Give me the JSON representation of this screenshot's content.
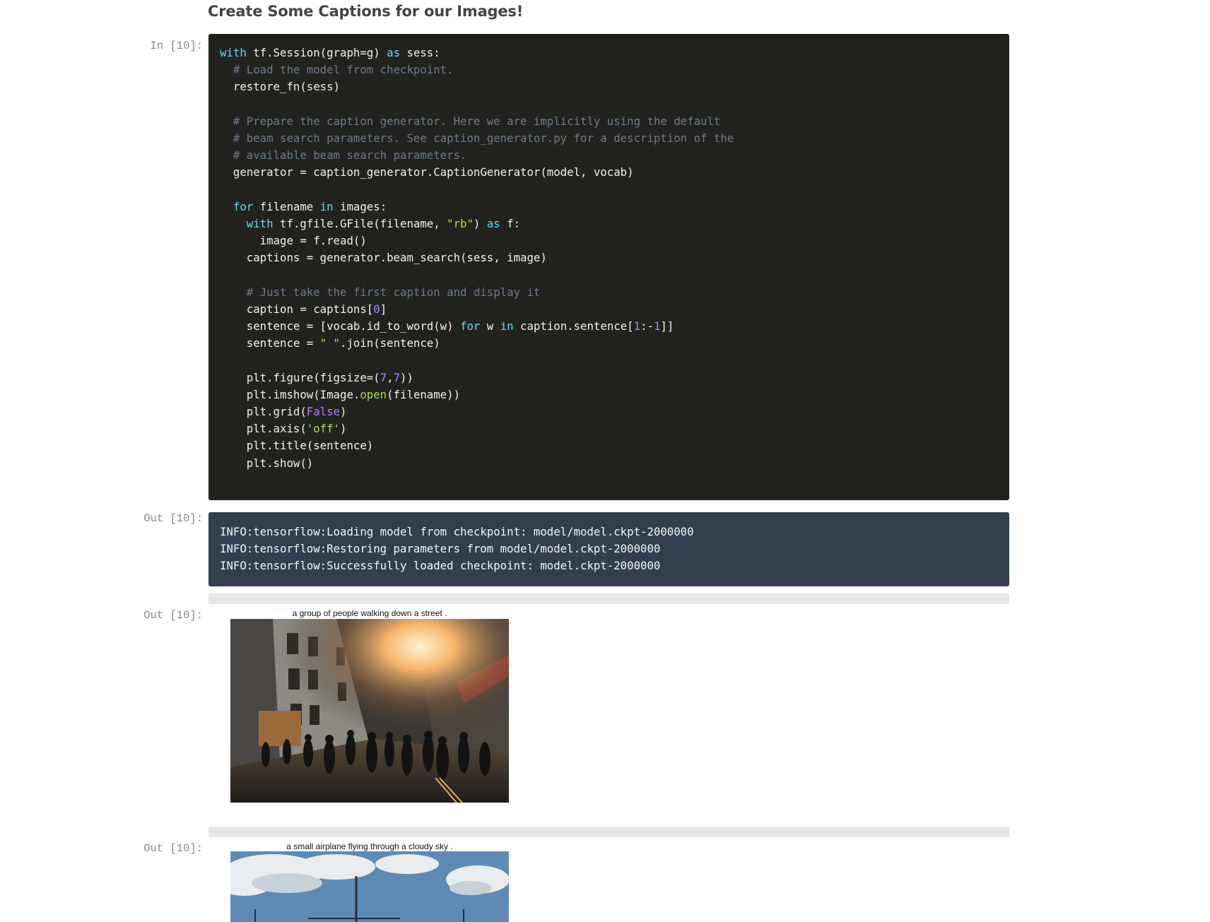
{
  "heading": "Create Some Captions for our Images!",
  "prompts": {
    "in": "In [10]:",
    "out1": "Out [10]:",
    "out2": "Out [10]:",
    "out3": "Out [10]:"
  },
  "output_lines": [
    "INFO:tensorflow:Loading model from checkpoint: model/model.ckpt-2000000",
    "INFO:tensorflow:Restoring parameters from model/model.ckpt-2000000",
    "INFO:tensorflow:Successfully loaded checkpoint: model.ckpt-2000000"
  ],
  "figures": [
    {
      "caption": "a group of people walking down a street .",
      "image_name": "city-street-crowd-photo"
    },
    {
      "caption": "a small airplane flying through a cloudy sky .",
      "image_name": "airplane-cloudy-sky-photo"
    }
  ],
  "colors": {
    "code_background": "#22231f",
    "output_background": "#333f4e",
    "keyword": "#66d9ef",
    "comment": "#6c7a8a",
    "string": "#a6e22e",
    "number": "#ae81ff"
  }
}
